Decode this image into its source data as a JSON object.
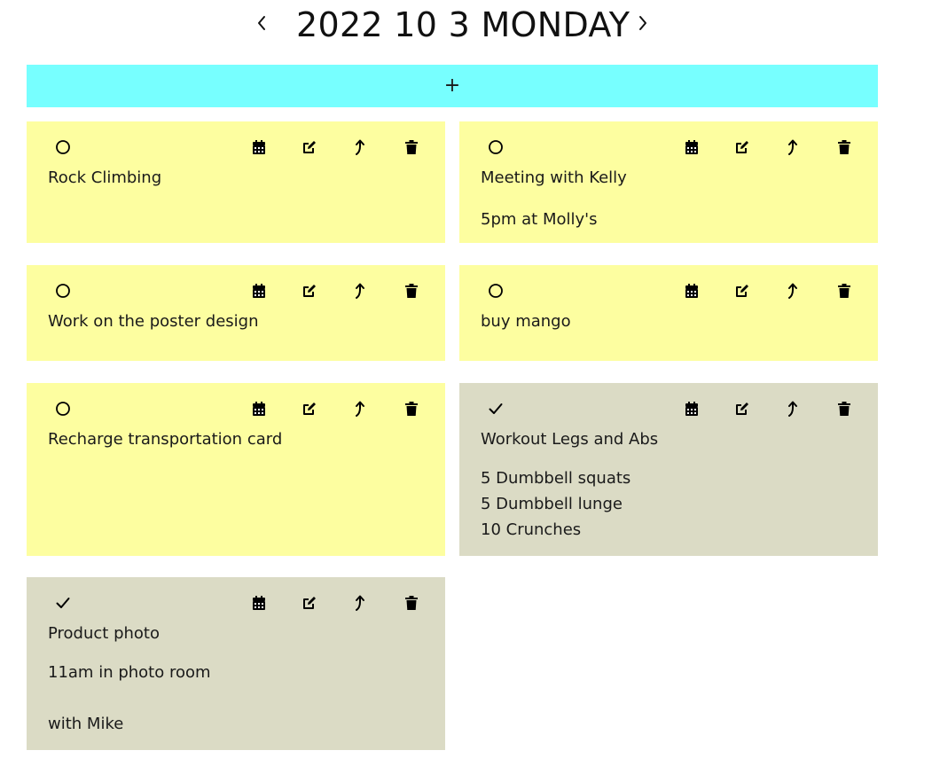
{
  "header": {
    "date_title": "2022 10 3 MONDAY",
    "prev_icon": "chevron-left-icon",
    "next_icon": "chevron-right-icon"
  },
  "add_bar": {
    "label": "+",
    "color": "#77ffff"
  },
  "colors": {
    "pending": "#fdfea0",
    "done": "#dbdbc5"
  },
  "tasks": [
    {
      "title": "Rock Climbing",
      "note": "",
      "done": false
    },
    {
      "title": "Meeting with Kelly",
      "note": "5pm at Molly's",
      "done": false
    },
    {
      "title": "Work on the poster design",
      "note": "",
      "done": false
    },
    {
      "title": "buy mango",
      "note": "",
      "done": false
    },
    {
      "title": "Recharge transportation card",
      "note": "",
      "done": false
    },
    {
      "title": "Workout Legs and Abs",
      "note": "5 Dumbbell squats\n5 Dumbbell lunge\n10 Crunches",
      "done": true
    },
    {
      "title": "Product photo",
      "note": "11am in photo room\n\nwith Mike",
      "done": true
    }
  ],
  "action_icons": [
    "calendar-icon",
    "edit-icon",
    "move-up-icon",
    "trash-icon"
  ]
}
